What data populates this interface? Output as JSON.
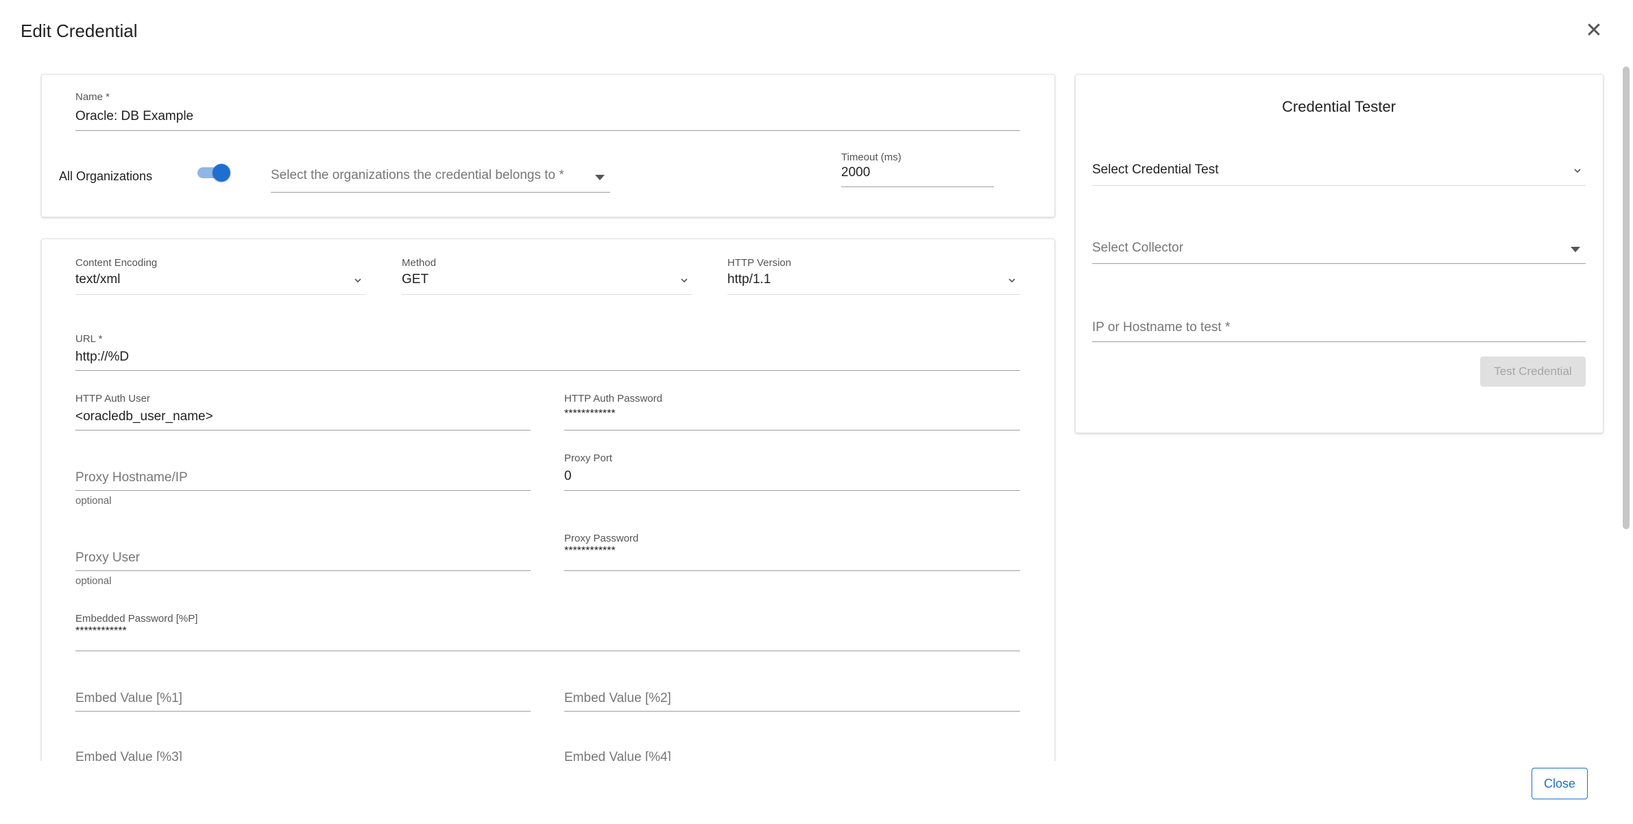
{
  "dialog": {
    "title": "Edit Credential",
    "close_icon": "close-icon"
  },
  "general": {
    "name_label": "Name *",
    "name_value": "Oracle: DB Example",
    "all_orgs_label": "All Organizations",
    "all_orgs_enabled": true,
    "orgs_placeholder": "Select the organizations the credential belongs to *",
    "timeout_label": "Timeout (ms)",
    "timeout_value": "2000"
  },
  "http": {
    "content_encoding_label": "Content Encoding",
    "content_encoding_value": "text/xml",
    "method_label": "Method",
    "method_value": "GET",
    "http_version_label": "HTTP Version",
    "http_version_value": "http/1.1",
    "url_label": "URL *",
    "url_value": "http://%D",
    "auth_user_label": "HTTP Auth User",
    "auth_user_value": "<oracledb_user_name>",
    "auth_password_label": "HTTP Auth Password",
    "auth_password_value": "************",
    "proxy_host_placeholder": "Proxy Hostname/IP",
    "proxy_host_helper": "optional",
    "proxy_port_label": "Proxy Port",
    "proxy_port_value": "0",
    "proxy_user_placeholder": "Proxy User",
    "proxy_user_helper": "optional",
    "proxy_password_label": "Proxy Password",
    "proxy_password_value": "************",
    "embedded_password_label": "Embedded Password [%P]",
    "embedded_password_value": "************",
    "embed1_placeholder": "Embed Value [%1]",
    "embed2_placeholder": "Embed Value [%2]",
    "embed3_placeholder": "Embed Value [%3]",
    "embed4_placeholder": "Embed Value [%4]"
  },
  "tester": {
    "title": "Credential Tester",
    "credential_test_placeholder": "Select Credential Test",
    "collector_placeholder": "Select Collector",
    "hostname_placeholder": "IP or Hostname to test *",
    "test_button_label": "Test Credential"
  },
  "footer": {
    "close_label": "Close"
  },
  "colors": {
    "accent": "#1e6fd1",
    "toggle_track": "#8fb6e6",
    "disabled_button": "#e0e0e0"
  }
}
